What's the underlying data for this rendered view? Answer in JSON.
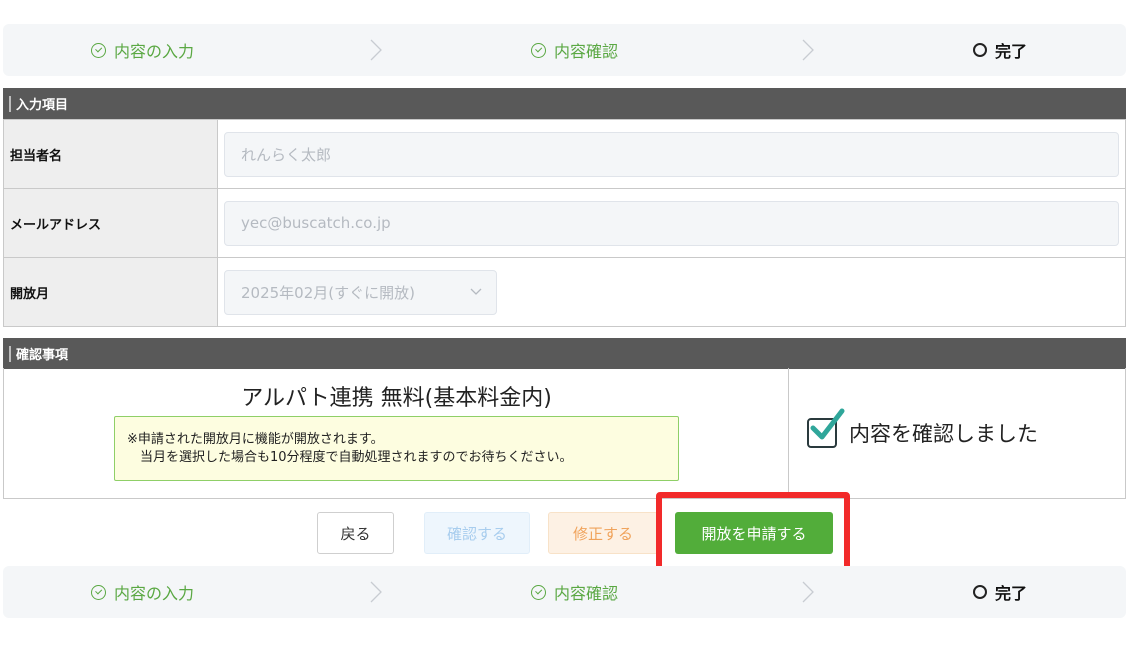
{
  "stepper": {
    "steps": [
      {
        "label": "内容の入力",
        "state": "done"
      },
      {
        "label": "内容確認",
        "state": "done"
      },
      {
        "label": "完了",
        "state": "current"
      }
    ]
  },
  "form": {
    "section_title": "入力項目",
    "fields": [
      {
        "label": "担当者名",
        "placeholder": "れんらく太郎"
      },
      {
        "label": "メールアドレス",
        "placeholder": "yec@buscatch.co.jp"
      },
      {
        "label": "開放月",
        "value": "2025年02月(すぐに開放)"
      }
    ]
  },
  "confirm": {
    "section_title": "確認事項",
    "title": "アルパト連携 無料(基本料金内)",
    "notice_line1": "※申請された開放月に機能が開放されます。",
    "notice_line2": "当月を選択した場合も10分程度で自動処理されますのでお待ちください。",
    "checkbox_label": "内容を確認しました",
    "checked": true
  },
  "buttons": {
    "back": "戻る",
    "confirm": "確認する",
    "edit": "修正する",
    "apply": "開放を申請する"
  },
  "colors": {
    "accent_green": "#52ad3a",
    "highlight_red": "#f22a2a",
    "section_bar": "#595959"
  }
}
